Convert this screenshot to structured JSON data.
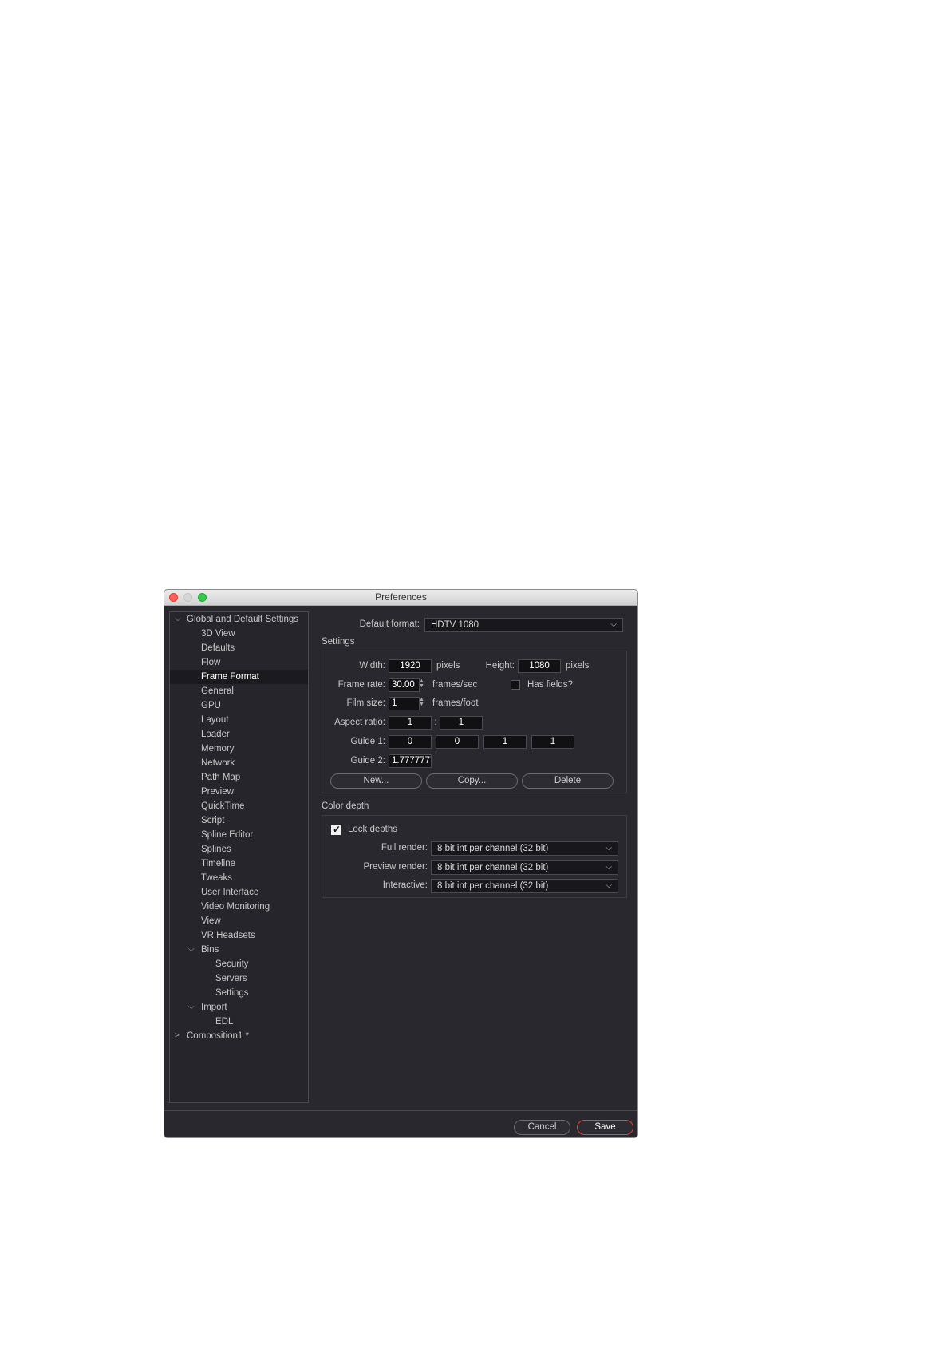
{
  "window": {
    "title": "Preferences"
  },
  "tree": {
    "items": [
      {
        "label": "Global and Default Settings",
        "expanded": true
      },
      {
        "label": "3D View"
      },
      {
        "label": "Defaults"
      },
      {
        "label": "Flow"
      },
      {
        "label": "Frame Format",
        "selected": true
      },
      {
        "label": "General"
      },
      {
        "label": "GPU"
      },
      {
        "label": "Layout"
      },
      {
        "label": "Loader"
      },
      {
        "label": "Memory"
      },
      {
        "label": "Network"
      },
      {
        "label": "Path Map"
      },
      {
        "label": "Preview"
      },
      {
        "label": "QuickTime"
      },
      {
        "label": "Script"
      },
      {
        "label": "Spline Editor"
      },
      {
        "label": "Splines"
      },
      {
        "label": "Timeline"
      },
      {
        "label": "Tweaks"
      },
      {
        "label": "User Interface"
      },
      {
        "label": "Video Monitoring"
      },
      {
        "label": "View"
      },
      {
        "label": "VR Headsets"
      },
      {
        "label": "Bins",
        "expanded": true
      },
      {
        "label": "Security"
      },
      {
        "label": "Servers"
      },
      {
        "label": "Settings"
      },
      {
        "label": "Import",
        "expanded": true
      },
      {
        "label": "EDL"
      },
      {
        "label": "Composition1 *",
        "expanded": false
      }
    ]
  },
  "format": {
    "default_format_label": "Default format:",
    "default_format_value": "HDTV 1080",
    "settings_heading": "Settings",
    "width_label": "Width:",
    "width_value": "1920",
    "width_unit": "pixels",
    "height_label": "Height:",
    "height_value": "1080",
    "height_unit": "pixels",
    "frame_rate_label": "Frame rate:",
    "frame_rate_value": "30.00",
    "frame_rate_unit": "frames/sec",
    "has_fields_label": "Has fields?",
    "has_fields_checked": false,
    "film_size_label": "Film size:",
    "film_size_value": "1",
    "film_size_unit": "frames/foot",
    "aspect_ratio_label": "Aspect ratio:",
    "aspect_x": "1",
    "aspect_sep": ":",
    "aspect_y": "1",
    "guide1_label": "Guide 1:",
    "guide1_values": [
      "0",
      "0",
      "1",
      "1"
    ],
    "guide2_label": "Guide 2:",
    "guide2_value": "1.7777777",
    "new_button": "New...",
    "copy_button": "Copy...",
    "delete_button": "Delete"
  },
  "color_depth": {
    "heading": "Color depth",
    "lock_depths_label": "Lock depths",
    "lock_depths_checked": true,
    "full_render_label": "Full render:",
    "full_render_value": "8 bit int per channel (32 bit)",
    "preview_render_label": "Preview render:",
    "preview_render_value": "8 bit int per channel (32 bit)",
    "interactive_label": "Interactive:",
    "interactive_value": "8 bit int per channel (32 bit)"
  },
  "footer": {
    "cancel": "Cancel",
    "save": "Save",
    "accent": "#e8403a"
  },
  "icons": {
    "expand": "chevron-down-icon",
    "collapse": "chevron-right-icon",
    "dropdown": "chevron-down-icon",
    "spinner": "up-down-arrows-icon",
    "check": "checkmark-icon"
  }
}
